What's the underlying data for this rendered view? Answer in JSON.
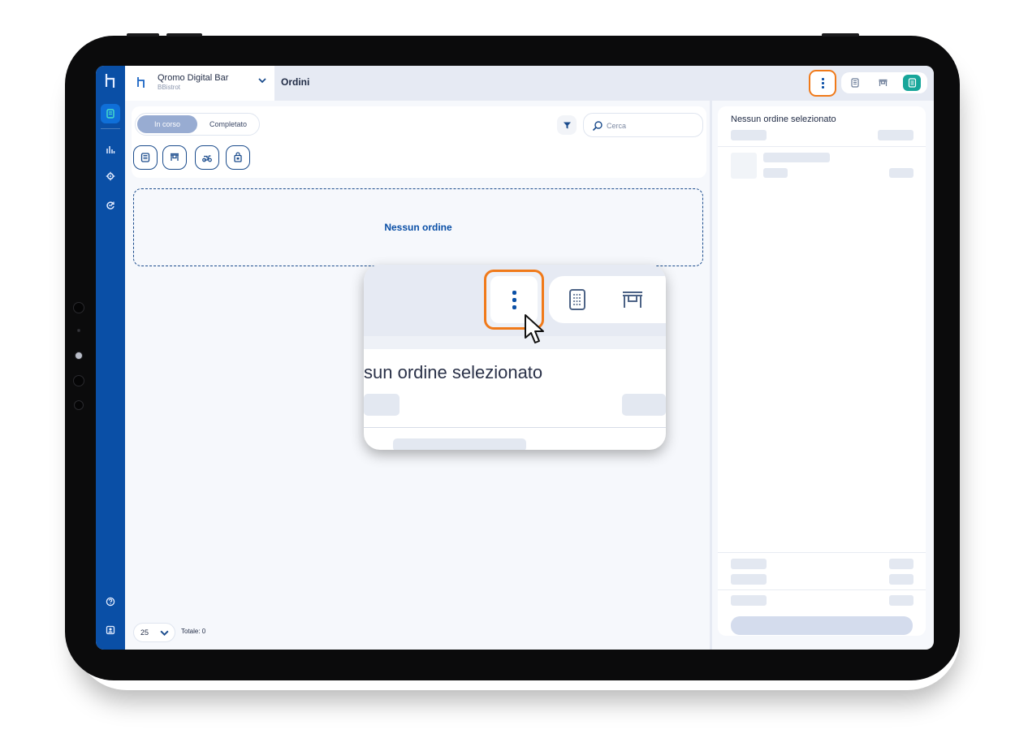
{
  "app": {
    "venue_name": "Qromo Digital Bar",
    "venue_subtitle": "BBistrot",
    "page_title": "Ordini"
  },
  "nav_rail": {
    "items": [
      {
        "name": "orders",
        "icon": "receipt-icon",
        "active": true
      },
      {
        "name": "stats",
        "icon": "bar-chart-icon",
        "active": false
      },
      {
        "name": "settings",
        "icon": "gear-icon",
        "active": false
      },
      {
        "name": "integrations",
        "icon": "sync-icon",
        "active": false
      }
    ],
    "bottom_items": [
      {
        "name": "help",
        "icon": "help-icon"
      },
      {
        "name": "account",
        "icon": "user-icon"
      }
    ]
  },
  "header": {
    "mode_buttons": [
      {
        "name": "tablet",
        "icon": "tablet-icon",
        "active": false
      },
      {
        "name": "table",
        "icon": "table-icon",
        "active": false
      },
      {
        "name": "list",
        "icon": "list-icon",
        "active": true
      }
    ]
  },
  "filters": {
    "status_tabs": [
      {
        "label": "In corso",
        "active": true
      },
      {
        "label": "Completato",
        "active": false
      }
    ],
    "channels": [
      {
        "name": "tablet",
        "icon": "tablet-icon"
      },
      {
        "name": "table",
        "icon": "table-icon"
      },
      {
        "name": "delivery",
        "icon": "scooter-icon"
      },
      {
        "name": "takeaway",
        "icon": "bag-icon"
      }
    ],
    "search_placeholder": "Cerca"
  },
  "orders": {
    "empty_message": "Nessun ordine"
  },
  "pagination": {
    "page_size": "25",
    "total_label": "Totale: 0"
  },
  "detail_panel": {
    "title": "Nessun ordine selezionato"
  },
  "zoom_callout": {
    "title": "sun ordine selezionato"
  },
  "colors": {
    "brand_blue": "#0a4fa6",
    "highlight_orange": "#f07a1a",
    "active_teal": "#17a69a",
    "accent_cyan": "#48e0c8"
  }
}
